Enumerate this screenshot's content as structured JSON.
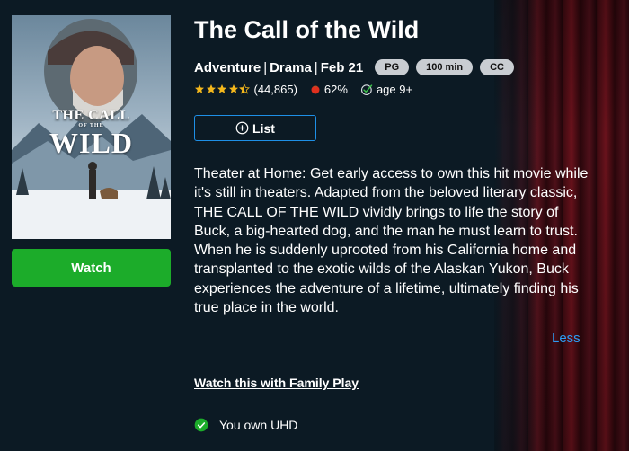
{
  "movie": {
    "title": "The Call of the Wild",
    "genres_date": [
      "Adventure",
      "Drama",
      "Feb 21"
    ],
    "badges": [
      "PG",
      "100 min",
      "CC"
    ],
    "star_rating": 4.5,
    "review_count": "(44,865)",
    "tomato_score": "62%",
    "age": "age 9+",
    "poster": {
      "title_line1": "THE CALL",
      "title_line2": "OF THE",
      "title_line3": "WILD"
    },
    "description": "Theater at Home: Get early access to own this hit movie while it's still in theaters. Adapted from the beloved literary classic, THE CALL OF THE WILD vividly brings to life the story of Buck, a big-hearted dog, and the man he must learn to trust. When he is suddenly uprooted from his California home and transplanted to the exotic wilds of the Alaskan Yukon, Buck experiences the adventure of a lifetime, ultimately finding his true place in the world."
  },
  "actions": {
    "watch_label": "Watch",
    "list_label": "List",
    "less_label": "Less",
    "family_play_label": "Watch this with Family Play",
    "ownership_label": "You own UHD"
  },
  "colors": {
    "background": "#0c1a24",
    "watch_green": "#1cac2a",
    "accent_blue": "#1e8fe6",
    "link_blue": "#2e9cf2",
    "star_gold": "#f5b81c",
    "pill_gray": "#c9cdd2"
  },
  "icons": [
    "star-icon",
    "tomato-icon",
    "age-check-icon",
    "plus-circle-icon",
    "check-circle-icon"
  ]
}
